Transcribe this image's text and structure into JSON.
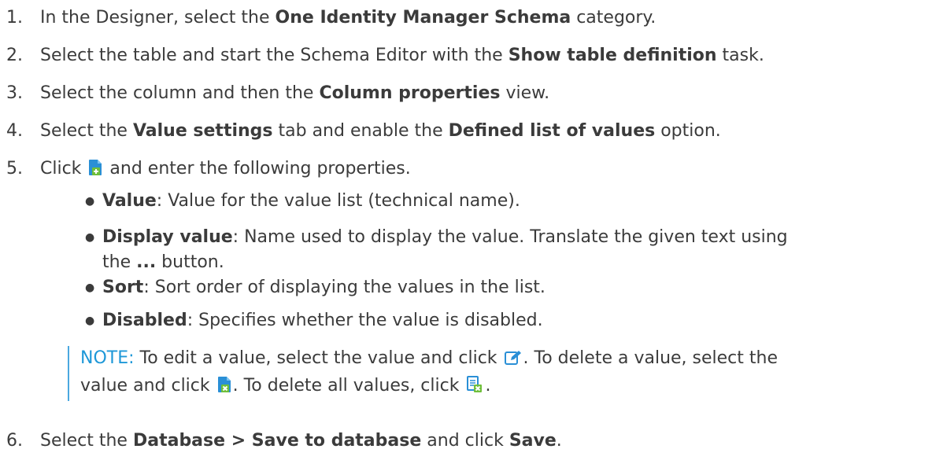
{
  "steps": [
    {
      "num": "1.",
      "pre": "In the Designer, select the ",
      "b1": "One Identity Manager Schema",
      "post": " category."
    },
    {
      "num": "2.",
      "pre": "Select the table and start the Schema Editor with the ",
      "b1": "Show table definition",
      "post": " task."
    },
    {
      "num": "3.",
      "pre": "Select the column and then the ",
      "b1": "Column properties",
      "post": " view."
    },
    {
      "num": "4.",
      "pre": "Select the ",
      "b1": "Value settings",
      "mid": " tab and enable the ",
      "b2": "Defined list of values",
      "post": " option."
    },
    {
      "num": "5.",
      "pre": "Click ",
      "post": " and enter the following properties."
    },
    {
      "num": "6.",
      "pre": "Select the ",
      "b1": "Database > Save to database",
      "mid": " and click ",
      "b2": "Save",
      "post": "."
    }
  ],
  "properties": [
    {
      "term": "Value",
      "desc": ": Value for the value list (technical name)."
    },
    {
      "term": "Display value",
      "desc": ": Name used to display the value. Translate the given text using",
      "desc2_pre": "the ",
      "desc2_b": "...",
      "desc2_post": " button."
    },
    {
      "term": "Sort",
      "desc": ": Sort order of displaying the values in the list."
    },
    {
      "term": "Disabled",
      "desc": ": Specifies whether the value is disabled."
    }
  ],
  "note": {
    "label": "NOTE:",
    "t1": " To edit a value, select the value and click ",
    "t2": ". To delete a value, select the",
    "t3": "value and click ",
    "t4": ". To delete all values, click ",
    "t5": "."
  },
  "icons": {
    "add": "add-value-icon",
    "edit": "edit-value-icon",
    "delete": "delete-value-icon",
    "delete_all": "delete-all-values-icon"
  },
  "colors": {
    "note_label": "#1e98d8",
    "note_bar": "#4ba8e0",
    "icon_blue": "#2a8fd6",
    "icon_green": "#6fbf3a"
  }
}
